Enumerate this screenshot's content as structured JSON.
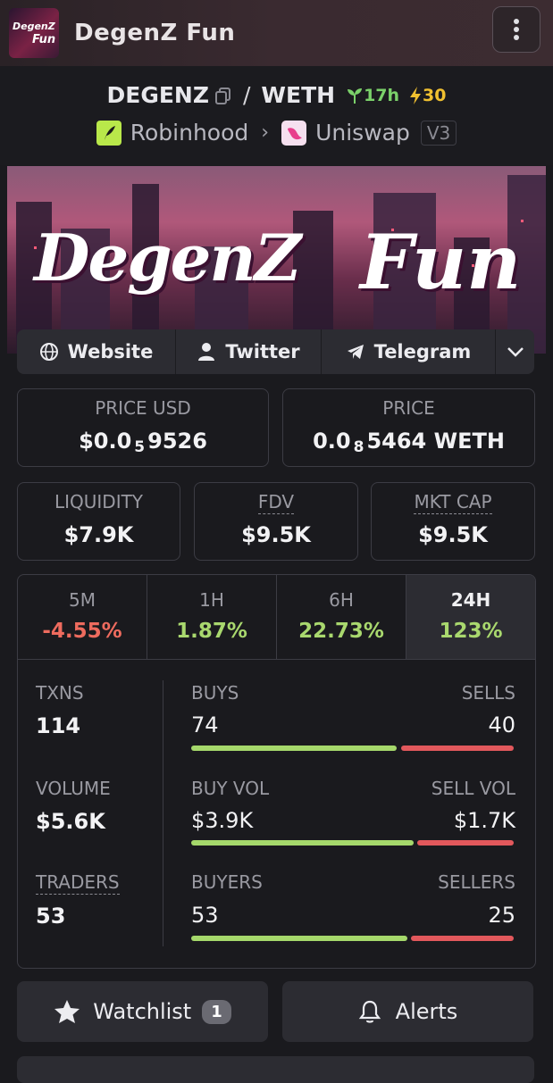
{
  "header": {
    "title": "DegenZ Fun",
    "logo_text_1": "DegenZ",
    "logo_text_2": "Fun"
  },
  "pair": {
    "base": "DEGENZ",
    "separator": "/",
    "quote": "WETH",
    "age": "17h",
    "boosts": "30",
    "chain": "Robinhood",
    "dex": "Uniswap",
    "version": "V3"
  },
  "banner": {
    "text_1": "DegenZ",
    "text_2": "Fun"
  },
  "links": {
    "website": "Website",
    "twitter": "Twitter",
    "telegram": "Telegram"
  },
  "prices": {
    "usd_label": "PRICE USD",
    "usd_prefix": "$0.0",
    "usd_zeros": "5",
    "usd_digits": "9526",
    "native_label": "PRICE",
    "native_prefix": "0.0",
    "native_zeros": "8",
    "native_digits": "5464 WETH"
  },
  "metrics": {
    "liquidity_label": "LIQUIDITY",
    "liquidity": "$7.9K",
    "fdv_label": "FDV",
    "fdv": "$9.5K",
    "mcap_label": "MKT CAP",
    "mcap": "$9.5K"
  },
  "timeframes": [
    {
      "label": "5M",
      "change": "-4.55%"
    },
    {
      "label": "1H",
      "change": "1.87%"
    },
    {
      "label": "6H",
      "change": "22.73%"
    },
    {
      "label": "24H",
      "change": "123%"
    }
  ],
  "stats": {
    "txns_label": "TXNS",
    "txns": "114",
    "volume_label": "VOLUME",
    "volume": "$5.6K",
    "traders_label": "TRADERS",
    "traders": "53",
    "buys_label": "BUYS",
    "buys": "74",
    "sells_label": "SELLS",
    "sells": "40",
    "buy_vol_label": "BUY VOL",
    "buy_vol": "$3.9K",
    "sell_vol_label": "SELL VOL",
    "sell_vol": "$1.7K",
    "buyers_label": "BUYERS",
    "buyers": "53",
    "sellers_label": "SELLERS",
    "sellers": "25"
  },
  "actions": {
    "watchlist": "Watchlist",
    "watchlist_count": "1",
    "alerts": "Alerts"
  },
  "colors": {
    "positive": "#a9d86e",
    "negative": "#ee6b5e",
    "age": "#7bd16a",
    "boost": "#f0c030"
  }
}
